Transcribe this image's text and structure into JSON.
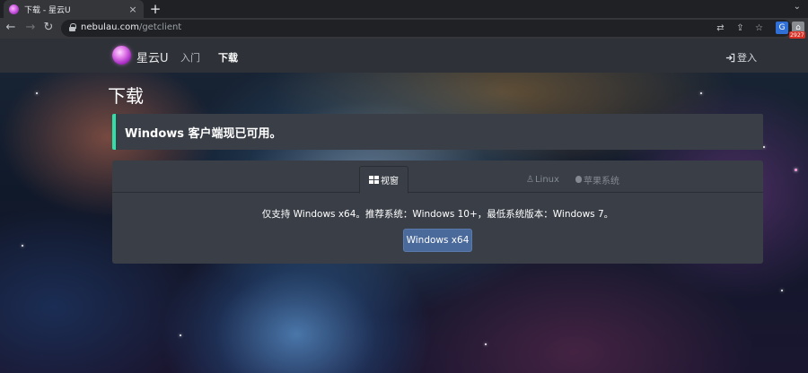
{
  "browser": {
    "tab_title": "下载 - 星云U",
    "tab_close": "×",
    "new_tab": "+",
    "tab_menu": "⌄",
    "url_domain": "nebulau.com",
    "url_path": "/getclient",
    "extension_badge": "2927"
  },
  "navbar": {
    "brand": "星云U",
    "links": [
      "入门",
      "下载"
    ],
    "active_link": "下载",
    "login": "登入"
  },
  "page": {
    "title": "下载",
    "alert": "Windows 客户端现已可用。",
    "platform_tabs": [
      {
        "label": "视窗",
        "icon": "windows-icon",
        "active": true
      },
      {
        "label": "Linux",
        "icon": "linux-icon",
        "active": false
      },
      {
        "label": "苹果系统",
        "icon": "apple-icon",
        "active": false
      }
    ],
    "requirements": "仅支持 Windows x64。推荐系统：Windows 10+，最低系统版本：Windows 7。",
    "download_button": "Windows x64"
  },
  "colors": {
    "alert_accent": "#2fe0a8",
    "button": "#4a6a9b",
    "card_bg": "#3a3f47",
    "navbar_bg": "#2e3238"
  }
}
